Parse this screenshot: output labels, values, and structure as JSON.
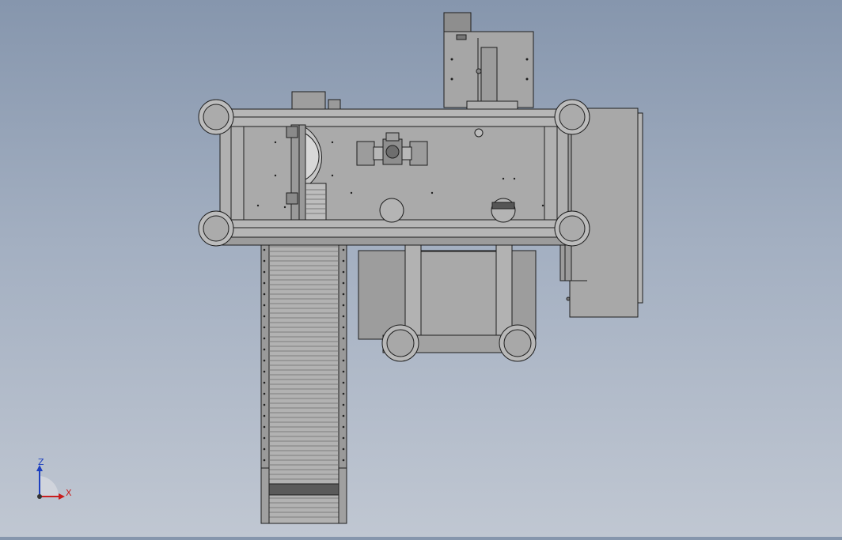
{
  "view": {
    "background_top": "#8696ad",
    "background_bottom": "#c0c7d2",
    "line_color": "#1e1e1e",
    "part_fill": "#a4a4a4",
    "part_fill_dark": "#8e8e8e",
    "part_fill_light": "#bababa"
  },
  "triad": {
    "z_label": "Z",
    "x_label": "X",
    "z_color": "#1c3fbf",
    "x_color": "#c81e1e"
  }
}
